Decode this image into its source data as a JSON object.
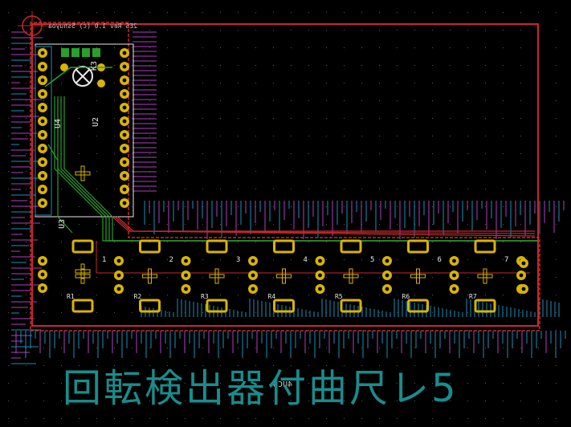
{
  "colors": {
    "background": "#000000",
    "board_outline": "#c8282c",
    "copper_front": "#c8282c",
    "copper_back": "#2aa02a",
    "pad": "#d9b400",
    "silkscreen": "#e8e8e8",
    "fab": "#b040c0",
    "courtyard": "#1c8fb8",
    "title": "#1a8c8c",
    "grid": "#5a5a5a"
  },
  "board": {
    "title": "回転検出器付曲尺レ5",
    "top_label": "2ES Rev 1.0 (c) 5shuyoa",
    "center_note": "4UCO"
  },
  "modules": [
    {
      "ref": "U4",
      "label": "U4"
    },
    {
      "ref": "U2",
      "label": "U2"
    },
    {
      "ref": "U3",
      "label": "U3"
    },
    {
      "ref": "K3",
      "label": "K3"
    }
  ],
  "switches": [
    {
      "ref": "SW1",
      "label": "1"
    },
    {
      "ref": "SW2",
      "label": "2"
    },
    {
      "ref": "SW3",
      "label": "3"
    },
    {
      "ref": "SW4",
      "label": "4"
    },
    {
      "ref": "SW5",
      "label": "5"
    },
    {
      "ref": "SW6",
      "label": "6"
    },
    {
      "ref": "SW7",
      "label": "7"
    }
  ],
  "resistor_labels": [
    "R1",
    "R2",
    "R3",
    "R4",
    "R5",
    "R6",
    "R7"
  ]
}
